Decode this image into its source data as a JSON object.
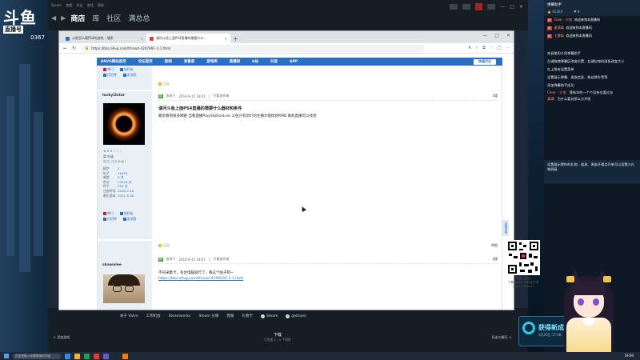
{
  "streamer_logo": {
    "big": "斗鱼",
    "mid": "直播号",
    "room": "0367"
  },
  "steam": {
    "menu": [
      "Steam",
      "查看",
      "好友",
      "游戏",
      "帮助"
    ],
    "tabs": [
      "商店",
      "库",
      "社区",
      "满总总"
    ],
    "footer_links": [
      "关于 Valve",
      "工作机会",
      "Steamworks",
      "Steam 分销",
      "客服",
      "礼物卡",
      "Steam",
      "@steam"
    ],
    "download_label": "下载",
    "download_sub": "已完成 1 / 1 个项目",
    "add_game": "添加游戏",
    "friends": "好友与聊天"
  },
  "browser": {
    "tabs": [
      {
        "label": "斗鱼怎么看PS4的游戏 - 搜索",
        "active": false
      },
      {
        "label": "请问斗鱼上面PS4直播的需要什么...",
        "active": true
      }
    ],
    "url": "https://bbs.a9vg.com/thread-4247891-1-1.html"
  },
  "forum": {
    "nav": [
      "A9VG网站首页",
      "论坛首页",
      "新闻",
      "发售表",
      "游戏库",
      "直播间",
      "b站",
      "抖音",
      "APP"
    ],
    "quick_reply": "快速可见",
    "top_post_buttons": [
      "串门",
      "加好友",
      "打招呼",
      "发消息"
    ],
    "post1_reply_label": "回复",
    "post1": {
      "username": "luckyl2star",
      "floor": "1楼",
      "author_label": "发表于",
      "time": "2014-9-15 18:01",
      "view_author": "只看该作者",
      "title": "请问斗鱼上面PS4直播的需要什么器材和条件",
      "body": "最近看到很多网路 当看直播PlayStationLive 斗鱼只有您们的主播才能找到RMB 联机直播可以找到",
      "level": "菜鸟级",
      "level_sub": "现在(正在充值)",
      "stars": "★★★☆☆☆",
      "stats": [
        {
          "k": "精华",
          "v": "2"
        },
        {
          "k": "帖子",
          "v": "11673"
        },
        {
          "k": "威望",
          "v": "6 点"
        },
        {
          "k": "积分",
          "v": "13418 点"
        },
        {
          "k": "种子",
          "v": "255 点"
        },
        {
          "k": "注册时间",
          "v": "2010-5-20"
        },
        {
          "k": "最后登录",
          "v": "2022-3-30"
        }
      ],
      "actions": [
        "串门",
        "加好友",
        "打招呼",
        "发消息"
      ]
    },
    "post2": {
      "reply_label": "回复",
      "floor": "2楼",
      "username": "shawnlee",
      "author_label": "发表于",
      "time": "2014-9-15 18:07",
      "view_author": "只看该作者",
      "body": "不同采集卡，有台电脑就行了，看这个帖子吧~",
      "link": "https://bbs.a9vg.com/thread-4199530-1-1.html",
      "report": "举报"
    },
    "qr_text": [
      "扫描二维码",
      "下载 A9VG 手机客户端",
      "(iOS, Android)"
    ],
    "float_label": "返回顶部"
  },
  "taskbar": {
    "search_placeholder": "在这里输入你要搜索的内容",
    "time": "19:00"
  },
  "chat": {
    "title": "弹幕助手",
    "viewers": "41364",
    "fans": "8",
    "gifts": [
      {
        "badge": "好",
        "who": "Clear - 夕渐",
        "msg": "欢迎来到本直播间"
      },
      {
        "badge": "好",
        "who": "星满满",
        "msg": "欢迎来到本直播间"
      },
      {
        "badge": "好",
        "who": "七零喵",
        "msg": "欢迎来到本直播间"
      }
    ],
    "notes": [
      "欢迎使用斗鱼弹幕助手",
      "左键拖拽弹幕区改变位置，右键拉伸的面板改变大小",
      "在上角有设置菜单",
      "设置展示弹幕、贵族信息、粉丝牌升等等",
      "添加弹幕助手成功"
    ],
    "messages": [
      {
        "nm": "Clear - 夕渐：",
        "msg": "我有冰的一个个没有在要过去",
        "cls": "nm"
      },
      {
        "nm": "满满：",
        "msg": "为什么要玩那么分开呢",
        "cls": "nm2"
      }
    ],
    "info_box": "设置展示牌你的礼物、道具、贵族开通点开来可以设置小礼物屏蔽"
  },
  "banner": {
    "title": "获得新成",
    "sub": "3月20日 17:08"
  }
}
